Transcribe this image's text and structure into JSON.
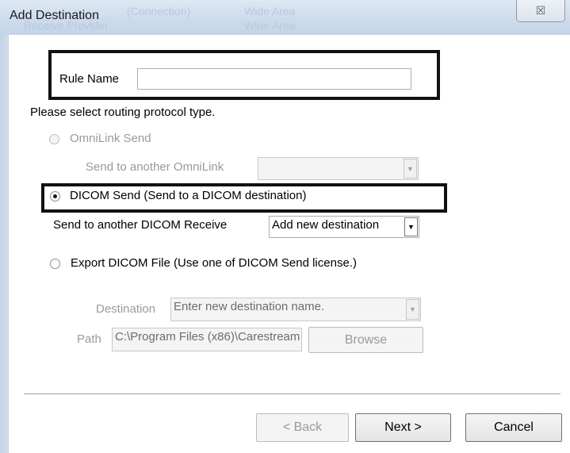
{
  "window": {
    "title": "Add Destination",
    "close_label": "☒"
  },
  "background_ghost": [
    "(Connection)",
    "Wide Area",
    "Receive Provider",
    "Wide Area"
  ],
  "rule_name": {
    "label": "Rule Name",
    "value": ""
  },
  "prompt": "Please select routing protocol type.",
  "omnilink": {
    "label": "OmniLink Send",
    "selected": false,
    "enabled": false,
    "sub_label": "Send to another  OmniLink",
    "dropdown_value": ""
  },
  "dicom_send": {
    "label": "DICOM Send (Send to a DICOM destination)",
    "selected": true,
    "enabled": true,
    "sub_label": "Send to another  DICOM Receive",
    "dropdown_value": "Add new destination"
  },
  "export_dicom": {
    "label": "Export DICOM File (Use one of DICOM Send license.)",
    "selected": false,
    "enabled": true,
    "destination_label": "Destination",
    "destination_value": "Enter new destination name.",
    "path_label": "Path",
    "path_value": "C:\\Program Files (x86)\\Carestream",
    "browse_label": "Browse"
  },
  "footer": {
    "back_label": "< Back",
    "next_label": "Next >",
    "cancel_label": "Cancel"
  },
  "icons": {
    "dropdown": "chevron-down-icon",
    "radio": "radio-icon",
    "close": "close-icon"
  }
}
